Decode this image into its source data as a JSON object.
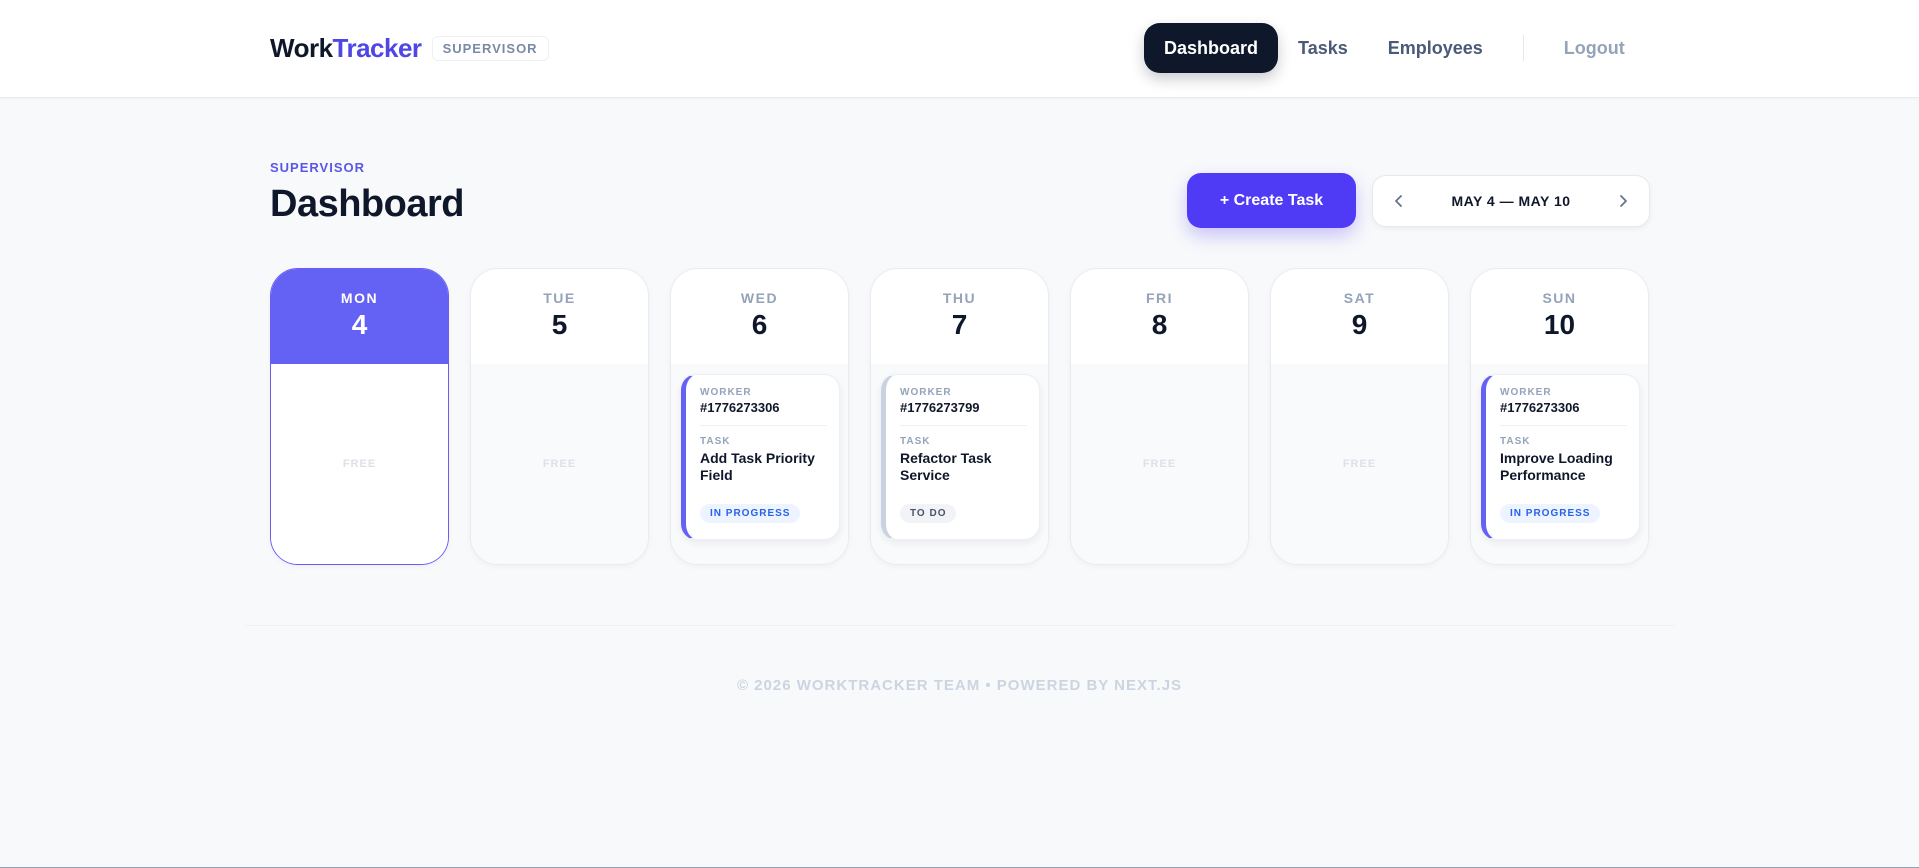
{
  "header": {
    "brand_part1": "Work",
    "brand_part2": "Tracker",
    "role_badge": "SUPERVISOR",
    "nav": {
      "dashboard": "Dashboard",
      "tasks": "Tasks",
      "employees": "Employees",
      "logout": "Logout"
    }
  },
  "page": {
    "kicker": "SUPERVISOR",
    "title": "Dashboard",
    "create_button": "+ Create Task",
    "week_range": "MAY 4 — MAY 10"
  },
  "labels": {
    "worker": "WORKER",
    "task": "TASK",
    "free": "FREE"
  },
  "days": [
    {
      "name": "MON",
      "num": "4",
      "today": true
    },
    {
      "name": "TUE",
      "num": "5"
    },
    {
      "name": "WED",
      "num": "6",
      "task": {
        "worker": "#1776273306",
        "title": "Add Task Priority Field",
        "status": "IN PROGRESS"
      }
    },
    {
      "name": "THU",
      "num": "7",
      "task": {
        "worker": "#1776273799",
        "title": "Refactor Task Service",
        "status": "TO DO"
      }
    },
    {
      "name": "FRI",
      "num": "8"
    },
    {
      "name": "SAT",
      "num": "9"
    },
    {
      "name": "SUN",
      "num": "10",
      "task": {
        "worker": "#1776273306",
        "title": "Improve Loading Performance",
        "status": "IN PROGRESS"
      }
    }
  ],
  "footer": "© 2026 WORKTRACKER TEAM • POWERED BY NEXT.JS",
  "colors": {
    "accent": "#4f3bf6",
    "today": "#6461f5",
    "dark": "#0f172a"
  }
}
